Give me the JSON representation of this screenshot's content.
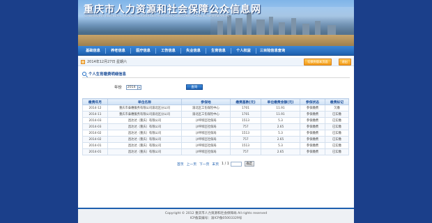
{
  "header": {
    "title": "重庆市人力资源和社会保障公众信息网",
    "subtitle": "CHONGQING MUNICIPAL HUMAN RESOURCES AND SOCIAL SECURITY PUBLIC INFORMATION"
  },
  "nav": {
    "items": [
      "基础信息",
      "养老信息",
      "医疗信息",
      "工伤信息",
      "失业信息",
      "生育信息",
      "个人权益",
      "三目险信息查询"
    ]
  },
  "infobar": {
    "date": "2014年12月27日 星期六",
    "button1": "切换到版本页面",
    "button2": "退出"
  },
  "section": {
    "title": "个人生育缴费明细信息"
  },
  "filter": {
    "year_label": "年份",
    "year_value": "2014",
    "query_button": "查询"
  },
  "table": {
    "headers": [
      "缴费年月",
      "单位名称",
      "参保地",
      "缴费基数(元)",
      "单位缴费金额(元)",
      "参保状态",
      "缴费标记"
    ],
    "rows": [
      [
        "2014-12",
        "重庆市泰穗服务有限公司渝北区分公司",
        "渝北区工伤保险中心",
        "1701",
        "11.91",
        "参保缴费",
        "欠缴"
      ],
      [
        "2014-11",
        "重庆市泰穗服务有限公司渝北区分公司",
        "渝北区工伤保险中心",
        "1701",
        "11.91",
        "参保缴费",
        "已实缴"
      ],
      [
        "2014-03",
        "昌达达（重庆）有限公司",
        "沙坪坝区社保局",
        "1513",
        "5.3",
        "参保缴费",
        "已实缴"
      ],
      [
        "2014-03",
        "昌达达（重庆）有限公司",
        "沙坪坝区社保局",
        "757",
        "2.65",
        "参保缴费",
        "已实缴"
      ],
      [
        "2014-02",
        "昌达达（重庆）有限公司",
        "沙坪坝区社保局",
        "1513",
        "5.3",
        "参保缴费",
        "已实缴"
      ],
      [
        "2014-02",
        "昌达达（重庆）有限公司",
        "沙坪坝区社保局",
        "757",
        "2.65",
        "参保缴费",
        "已实缴"
      ],
      [
        "2014-01",
        "昌达达（重庆）有限公司",
        "沙坪坝区社保局",
        "1513",
        "5.3",
        "参保缴费",
        "已实缴"
      ],
      [
        "2014-01",
        "昌达达（重庆）有限公司",
        "沙坪坝区社保局",
        "757",
        "2.65",
        "参保缴费",
        "已实缴"
      ]
    ]
  },
  "pager": {
    "first": "首页",
    "prev": "上一页",
    "next": "下一页",
    "last": "末页",
    "page_info": "1 / 1",
    "go": "确定"
  },
  "footer": {
    "line1": "Copyright © 2012 重庆市人力资源和社会保障局 All rights reserved",
    "line2": "ICP备案编号：渝ICP备05003329号"
  }
}
